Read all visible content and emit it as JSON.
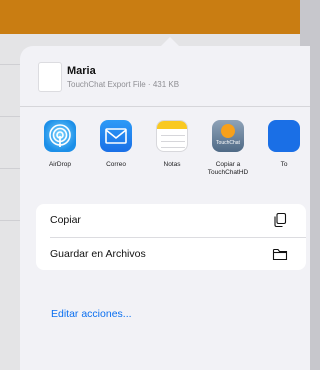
{
  "header": {
    "title": "Maria",
    "subtitle": "TouchChat Export File · 431 KB"
  },
  "apps": [
    {
      "label": "AirDrop",
      "icon": "airdrop-icon"
    },
    {
      "label": "Correo",
      "icon": "mail-icon"
    },
    {
      "label": "Notas",
      "icon": "notes-icon"
    },
    {
      "label": "Copiar a TouchChatHD",
      "icon": "touchchat-icon",
      "tile_text": "TouchChat"
    },
    {
      "label": "To",
      "icon": "app-icon"
    }
  ],
  "actions": [
    {
      "label": "Copiar",
      "icon": "copy-icon"
    },
    {
      "label": "Guardar en Archivos",
      "icon": "folder-icon"
    }
  ],
  "edit_actions": "Editar acciones...",
  "colors": {
    "accent": "#0a6ff0",
    "backdrop_bar": "#c97d12",
    "sheet_bg": "#f2f2f6"
  }
}
